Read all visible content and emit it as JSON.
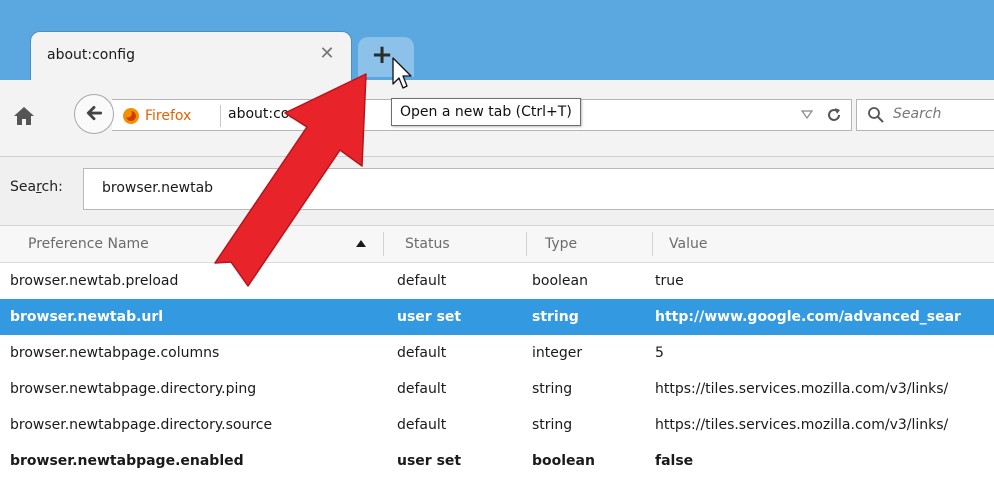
{
  "tabs": {
    "active_title": "about:config",
    "close_glyph": "✕",
    "new_tab_glyph": "+"
  },
  "navbar": {
    "identity_label": "Firefox",
    "url_text": "about:con",
    "search_placeholder": "Search"
  },
  "tooltip": {
    "text": "Open a new tab (Ctrl+T)"
  },
  "config": {
    "search_label_prefix": "Sea",
    "search_label_accel": "r",
    "search_label_suffix": "ch:",
    "search_value": "browser.newtab",
    "columns": {
      "name": "Preference Name",
      "status": "Status",
      "type": "Type",
      "value": "Value"
    },
    "rows": [
      {
        "name": "browser.newtab.preload",
        "status": "default",
        "type": "boolean",
        "value": "true"
      },
      {
        "name": "browser.newtab.url",
        "status": "user set",
        "type": "string",
        "value": "http://www.google.com/advanced_sear"
      },
      {
        "name": "browser.newtabpage.columns",
        "status": "default",
        "type": "integer",
        "value": "5"
      },
      {
        "name": "browser.newtabpage.directory.ping",
        "status": "default",
        "type": "string",
        "value": "https://tiles.services.mozilla.com/v3/links/"
      },
      {
        "name": "browser.newtabpage.directory.source",
        "status": "default",
        "type": "string",
        "value": "https://tiles.services.mozilla.com/v3/links/"
      },
      {
        "name": "browser.newtabpage.enabled",
        "status": "user set",
        "type": "boolean",
        "value": "false"
      }
    ]
  },
  "icons": {
    "home": "home-icon",
    "back": "back-arrow-icon",
    "firefox": "firefox-logo-icon",
    "dropdown": "dropdown-triangle-icon",
    "reload": "reload-icon",
    "search": "magnifier-icon",
    "cursor": "mouse-pointer-icon",
    "annotation": "red-arrow-annotation"
  },
  "colors": {
    "tabstrip": "#5ba8e0",
    "selected_row": "#3399e0",
    "annotation_red": "#e8232a",
    "firefox_orange": "#e66000"
  }
}
